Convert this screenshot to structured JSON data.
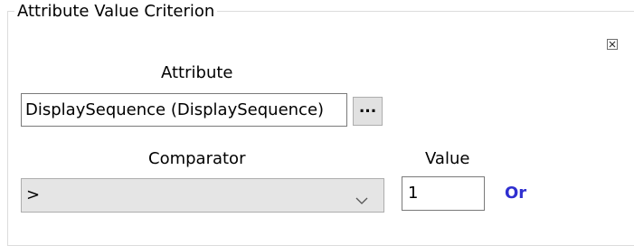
{
  "group": {
    "title": "Attribute Value Criterion",
    "remove_icon": "close-box-icon"
  },
  "attribute": {
    "label": "Attribute",
    "value": "DisplaySequence (DisplaySequence)",
    "browse_label": "..."
  },
  "comparator": {
    "label": "Comparator",
    "selected": ">",
    "arrow_icon": "chevron-down-icon"
  },
  "value": {
    "label": "Value",
    "current": "1"
  },
  "or_link": {
    "label": "Or",
    "color": "#2f2fd0"
  }
}
